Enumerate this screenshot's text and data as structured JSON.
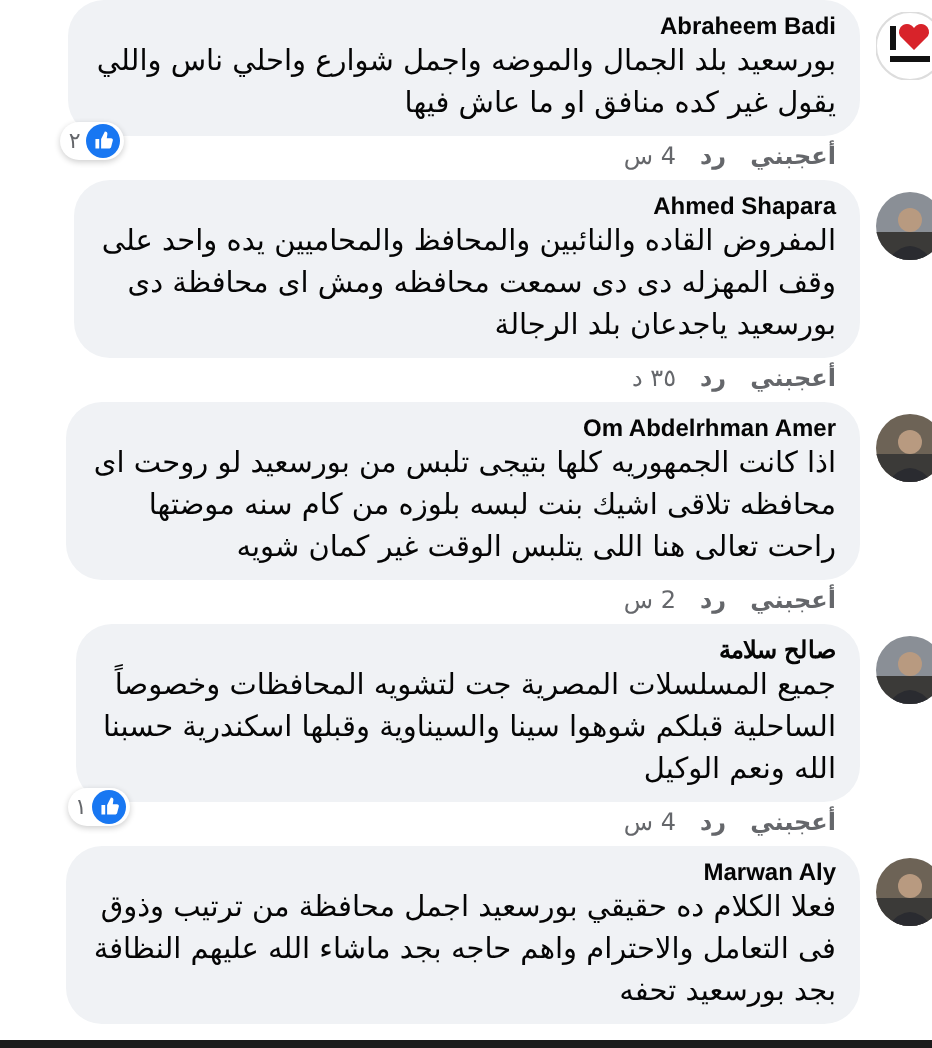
{
  "comments": [
    {
      "author": "Abraheem Badi",
      "kind": "logo",
      "body": "بورسعيد بلد الجمال والموضه واجمل شوارع واحلي ناس واللي\nيقول غير كده منافق او ما عاش فيها",
      "reactions": "٢",
      "like": "أعجبني",
      "reply": "رد",
      "time": "4 س"
    },
    {
      "author": "Ahmed Shapara",
      "body": "المفروض القاده والنائبين والمحافظ والمحاميين يده واحد على\nوقف المهزله دى دى سمعت محافظه ومش اى محافظة دى\nبورسعيد ياجدعان بلد الرجالة",
      "like": "أعجبني",
      "reply": "رد",
      "time": "٣٥ د"
    },
    {
      "author": "Om Abdelrhman Amer",
      "body": "اذا كانت الجمهوريه كلها بتيجى تلبس من بورسعيد لو روحت اى\nمحافظه تلاقى اشيك بنت لبسه بلوزه من كام سنه موضتها\nراحت تعالى هنا اللى يتلبس الوقت غير كمان شويه",
      "like": "أعجبني",
      "reply": "رد",
      "time": "2 س"
    },
    {
      "author": "صالح سلامة",
      "body": "جميع المسلسلات المصرية جت لتشويه المحافظات وخصوصاً\nالساحلية قبلكم شوهوا سينا والسيناوية وقبلها اسكندرية حسبنا\nالله ونعم الوكيل",
      "reactions": "١",
      "like": "أعجبني",
      "reply": "رد",
      "time": "4 س"
    },
    {
      "author": "Marwan Aly",
      "body": "فعلا الكلام ده حقيقي بورسعيد اجمل محافظة من ترتيب وذوق\nفى التعامل والاحترام واهم حاجه بجد ماشاء الله عليهم النظافة\nبجد بورسعيد تحفه"
    }
  ]
}
